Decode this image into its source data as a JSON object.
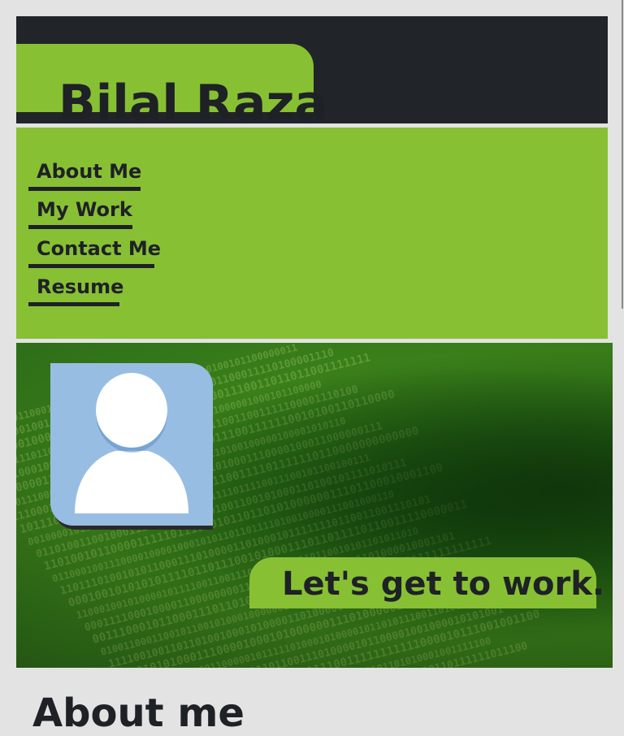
{
  "header": {
    "site_title": "Bilal Raza"
  },
  "nav": {
    "items": [
      {
        "label": "About Me"
      },
      {
        "label": "My Work"
      },
      {
        "label": "Contact Me"
      },
      {
        "label": "Resume"
      }
    ]
  },
  "hero": {
    "tagline": "Let's get to work.",
    "avatar_icon": "user-silhouette-icon",
    "background": "binary-code-pattern"
  },
  "sections": {
    "about_heading": "About me"
  },
  "colors": {
    "accent_green": "#88c034",
    "dark": "#212529",
    "text_dark": "#1e2126",
    "avatar_bg": "#98bde3",
    "page_bg": "#e3e3e3"
  }
}
